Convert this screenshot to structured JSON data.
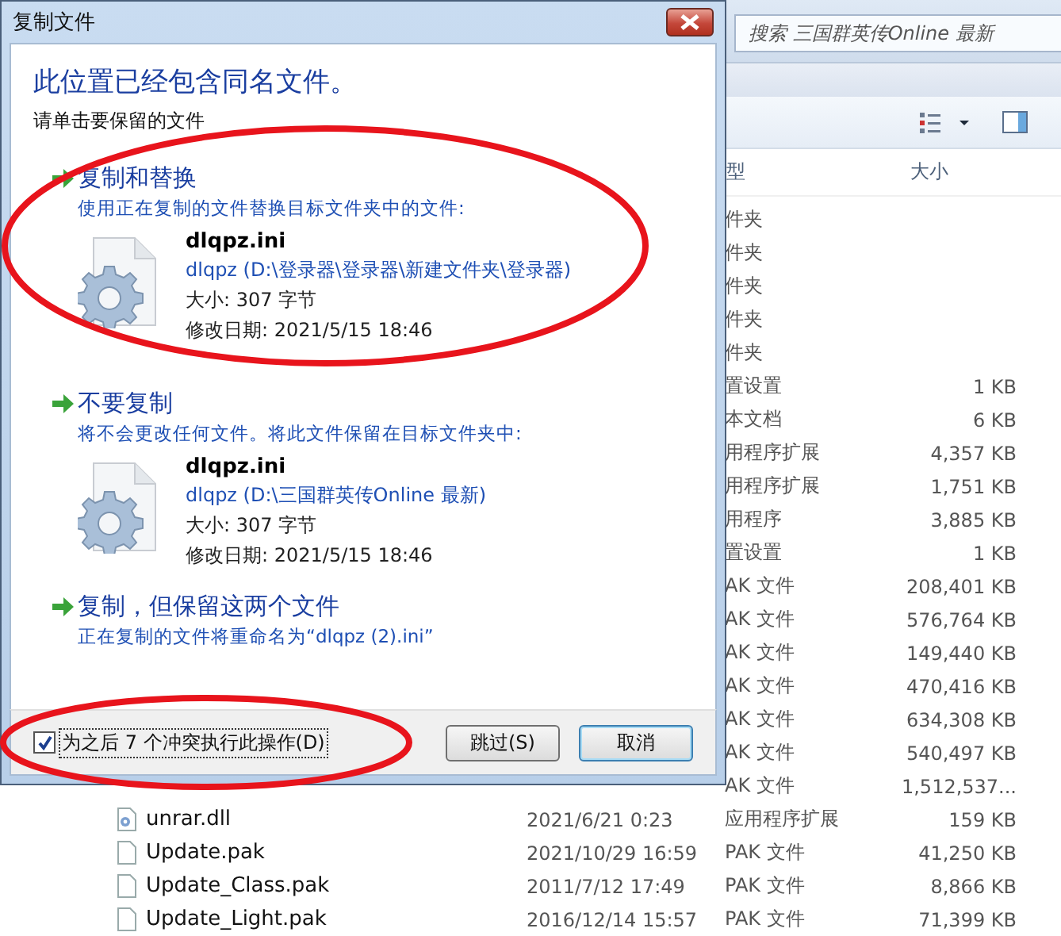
{
  "explorer": {
    "search": {
      "placeholder": "搜索 三国群英传Online 最新"
    },
    "columns": [
      "型",
      "大小"
    ],
    "rows": [
      {
        "type": "件夹"
      },
      {
        "type": "件夹"
      },
      {
        "type": "件夹"
      },
      {
        "type": "件夹"
      },
      {
        "type": "件夹"
      },
      {
        "type": "置设置",
        "size": "1 KB"
      },
      {
        "type": "本文档",
        "size": "6 KB"
      },
      {
        "type": "用程序扩展",
        "size": "4,357 KB"
      },
      {
        "type": "用程序扩展",
        "size": "1,751 KB"
      },
      {
        "type": "用程序",
        "size": "3,885 KB"
      },
      {
        "type": "置设置",
        "size": "1 KB"
      },
      {
        "type": "AK 文件",
        "size": "208,401 KB"
      },
      {
        "type": "AK 文件",
        "size": "576,764 KB"
      },
      {
        "type": "AK 文件",
        "size": "149,440 KB"
      },
      {
        "type": "AK 文件",
        "size": "470,416 KB"
      },
      {
        "type": "AK 文件",
        "size": "634,308 KB"
      },
      {
        "type": "AK 文件",
        "size": "540,497 KB"
      },
      {
        "type": "AK 文件",
        "size": "1,512,537..."
      },
      {
        "kind": "dll",
        "name": "unrar.dll",
        "date": "2021/6/21 0:23",
        "type": "应用程序扩展",
        "size": "159 KB"
      },
      {
        "kind": "file",
        "name": "Update.pak",
        "date": "2021/10/29 16:59",
        "type": "PAK 文件",
        "size": "41,250 KB"
      },
      {
        "kind": "file",
        "name": "Update_Class.pak",
        "date": "2011/7/12 17:49",
        "type": "PAK 文件",
        "size": "8,866 KB"
      },
      {
        "kind": "file",
        "name": "Update_Light.pak",
        "date": "2016/12/14 15:57",
        "type": "PAK 文件",
        "size": "71,399 KB"
      }
    ]
  },
  "dialog": {
    "title": "复制文件",
    "heading": "此位置已经包含同名文件。",
    "instruction": "请单击要保留的文件",
    "options": [
      {
        "title": "复制和替换",
        "description": "使用正在复制的文件替换目标文件夹中的文件:",
        "file": {
          "name": "dlqpz.ini",
          "location": "dlqpz (D:\\登录器\\登录器\\新建文件夹\\登录器)",
          "size": "大小: 307 字节",
          "modified": "修改日期: 2021/5/15 18:46"
        }
      },
      {
        "title": "不要复制",
        "description": "将不会更改任何文件。将此文件保留在目标文件夹中:",
        "file": {
          "name": "dlqpz.ini",
          "location": "dlqpz (D:\\三国群英传Online 最新)",
          "size": "大小: 307 字节",
          "modified": "修改日期: 2021/5/15 18:46"
        }
      },
      {
        "title": "复制，但保留这两个文件",
        "description": "正在复制的文件将重命名为“dlqpz (2).ini”"
      }
    ],
    "do_for_all": {
      "label": "为之后 7 个冲突执行此操作(D)",
      "checked": true
    },
    "buttons": [
      {
        "label": "跳过(S)",
        "default": false
      },
      {
        "label": "取消",
        "default": true
      }
    ]
  }
}
